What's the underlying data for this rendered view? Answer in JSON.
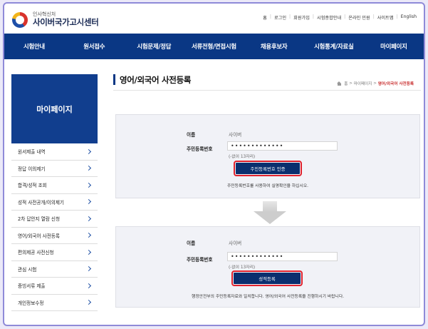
{
  "header": {
    "logo_top": "인사혁신처",
    "logo_main": "사이버국가고시센터",
    "util_links": [
      "홈",
      "로그인",
      "회원가입",
      "시험종합안내",
      "온라인 민원",
      "사이트맵",
      "English"
    ]
  },
  "gnb": [
    "시험안내",
    "원서접수",
    "시험문제/정답",
    "서류전형/면접시험",
    "채용후보자",
    "시험통계/자료실",
    "마이페이지"
  ],
  "sidebar": {
    "title": "마이페이지",
    "items": [
      "원서제출 내역",
      "정답 이의제기",
      "합격/성적 조회",
      "성적 사전공개/이의제기",
      "2차 답안지 열람 신청",
      "영어/외국어 사전등록",
      "편의제공 사전신청",
      "관심 시험",
      "증빙서류 제출",
      "개인정보수정"
    ]
  },
  "page": {
    "title": "영어/외국어 사전등록",
    "breadcrumb": [
      "홈",
      "마이페이지",
      "영어/외국어 사전등록"
    ]
  },
  "step1": {
    "name_label": "이름",
    "name_value": "사이버",
    "id_label": "주민등록번호",
    "id_value": "•••••••••••••",
    "id_hint": "(-없이 13자리)",
    "button": "주민등록번호 인증",
    "note": "주민등록번호를 사용하여 실명확인을 하십시오."
  },
  "step2": {
    "name_label": "이름",
    "name_value": "사이버",
    "id_label": "주민등록번호",
    "id_value": "•••••••••••••",
    "id_hint": "(-없이 13자리)",
    "button": "성적등록",
    "note": "행정안전부의 주민등록자료와 일치합니다. 영어/외국어 사전등록을 진행하시기 바랍니다."
  },
  "colors": {
    "navy": "#0a3784",
    "highlight": "#e0222d",
    "breadcrumb_current": "#c93030"
  },
  "icons": {
    "arrow": "down-arrow-icon",
    "home": "home-icon",
    "chevron": "chevron-right-icon"
  }
}
